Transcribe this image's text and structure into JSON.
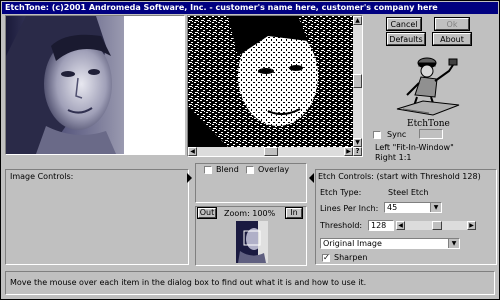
{
  "window": {
    "title": "EtchTone: (c)2001 Andromeda Software, Inc. - customer's name here, customer's company here"
  },
  "buttons": {
    "cancel": "Cancel",
    "ok": "Ok",
    "defaults": "Defaults",
    "about": "About"
  },
  "logo": {
    "caption": "EtchTone"
  },
  "sync": {
    "label": "Sync",
    "checked": false
  },
  "fit": {
    "line1": "Left \"Fit-In-Window\"",
    "line2": "Right 1:1"
  },
  "preview_scroll": {
    "question": "?"
  },
  "image_controls": {
    "title": "Image Controls:"
  },
  "blend": {
    "label": "Blend",
    "checked": false
  },
  "overlay": {
    "label": "Overlay",
    "checked": false
  },
  "zoom": {
    "out": "Out",
    "label": "Zoom: 100%",
    "in": "In"
  },
  "etch_controls": {
    "title": "Etch Controls: (start with Threshold 128)",
    "type_label": "Etch Type:",
    "type_value": "Steel Etch",
    "lpi_label": "Lines Per Inch:",
    "lpi_value": "45",
    "threshold_label": "Threshold:",
    "threshold_value": "128",
    "source_value": "Original Image",
    "sharpen_label": "Sharpen",
    "sharpen_checked": true
  },
  "status": {
    "text": "Move the mouse over each item in the dialog box to find out what it is and how to use it."
  },
  "colors": {
    "titlebar": "#000080",
    "face": "#c0c0c0"
  },
  "icons": [
    "check-icon",
    "dropdown-arrow-icon",
    "scroll-arrow-icon",
    "etcher-man-icon"
  ]
}
